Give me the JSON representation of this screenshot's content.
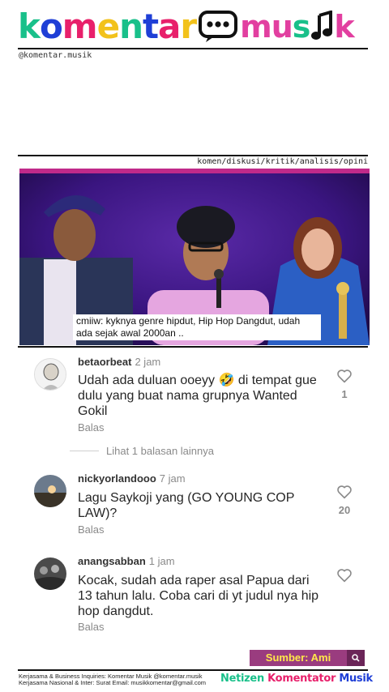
{
  "header": {
    "logo_text_part1": "komentar",
    "logo_text_part2": "musik",
    "logo_letters_colors": [
      "#19c08a",
      "#1f3fd6",
      "#e8206b",
      "#f2c21b",
      "#19c08a",
      "#1f3fd6",
      "#e8206b",
      "#f2c21b"
    ],
    "logo_part2_color": "#e23fa0",
    "handle": "@komentar.musik",
    "tags": "komen/diskusi/kritik/analisis/opini",
    "logo_bubble_icon": "chat-bubble-icon",
    "logo_note_icon": "music-note-icon"
  },
  "video": {
    "caption_line1": "cmiiw: kyknya genre hipdut, Hip Hop Dangdut, udah",
    "caption_line2": "ada sejak awal 2000an .."
  },
  "comments": [
    {
      "username": "betaorbeat",
      "time": "2 jam",
      "text_lines": [
        "Udah ada duluan ooeyy 🤣 di tempat gue",
        "dulu yang buat nama grupnya Wanted",
        "Gokil"
      ],
      "likes": "1",
      "reply_label": "Balas"
    },
    {
      "username": "nickyorlandooo",
      "time": "7 jam",
      "text_lines": [
        "Lagu Saykoji yang (GO YOUNG COP",
        "LAW)?"
      ],
      "likes": "20",
      "reply_label": "Balas"
    },
    {
      "username": "anangsabban",
      "time": "1 jam",
      "text_lines": [
        "Kocak, sudah ada raper asal Papua dari",
        "13 tahun lalu. Coba cari di yt judul nya hip",
        "hop dangdut."
      ],
      "likes": "",
      "reply_label": "Balas"
    }
  ],
  "more_replies": "Lihat 1 balasan lainnya",
  "footer": {
    "source": "Sumber: Ami",
    "inquiries_line1": "Kerjasama & Business Inquiries: Komentar Musik @komentar.musik",
    "inquiries_line2": "Kerjasama Nasional & Inter: Surat Email: musikkomentar@gmail.com",
    "netizen_part1": "Netizen",
    "netizen_part2": "Komentator",
    "netizen_part3": "Musik"
  },
  "colors": {
    "source_bg": "#9a3c7f",
    "source_text": "#ffe94a",
    "stage_bg": "#2a0e57"
  }
}
